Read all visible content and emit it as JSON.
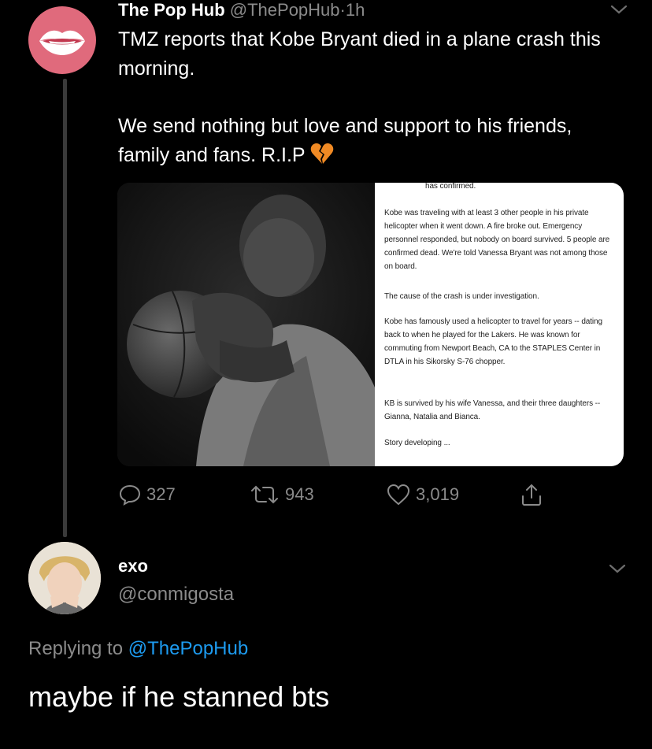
{
  "tweet": {
    "author_name": "The Pop Hub",
    "handle": "@ThePopHub",
    "separator": "·",
    "time": "1h",
    "text_line1": "TMZ reports that Kobe Bryant died in a plane crash this morning.",
    "text_line2": "We send nothing but love and support to his friends, family and fans. R.I.P",
    "emoji": "broken-heart-icon",
    "article": {
      "header": "has confirmed.",
      "p1": "Kobe was traveling with at least 3 other people in his private helicopter when it went down. A fire broke out. Emergency personnel responded, but nobody on board survived. 5 people are confirmed dead. We're told Vanessa Bryant was not among those on board.",
      "p2": "The cause of the crash is under investigation.",
      "p3": "Kobe has famously used a helicopter to travel for years -- dating back to when he played for the Lakers. He was known for commuting from Newport Beach, CA to the STAPLES Center in DTLA in his Sikorsky S-76 chopper.",
      "p4": "KB is survived by his wife Vanessa, and their three daughters -- Gianna, Natalia and Bianca.",
      "p5": "Story developing ..."
    },
    "stats": {
      "replies": "327",
      "retweets": "943",
      "likes": "3,019"
    }
  },
  "reply": {
    "author_name": "exo",
    "handle": "@conmigosta",
    "replying_prefix": "Replying to",
    "replying_mention": "@ThePopHub",
    "text": "maybe if he stanned bts"
  },
  "colors": {
    "background": "#000000",
    "text": "#e7e9ea",
    "muted": "#8b8b8b",
    "link": "#1d9bf0",
    "avatar_pink": "#e06a7c",
    "heart_orange": "#f08a24"
  }
}
